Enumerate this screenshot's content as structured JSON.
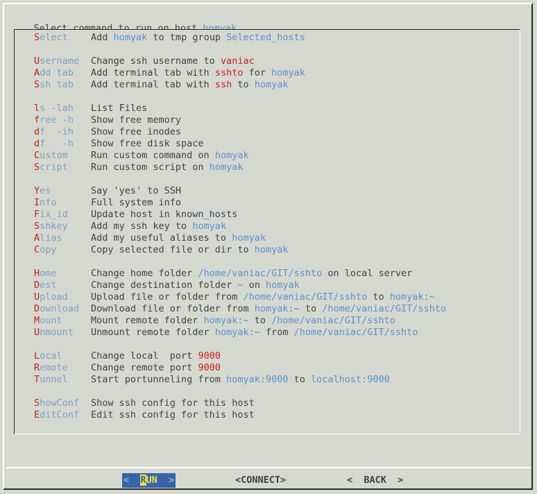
{
  "window": {
    "prompt_prefix": "Select command to run on host ",
    "prompt_host": "homyak",
    "prompt_suffix": "."
  },
  "colors": {
    "background": "#d6d9d0",
    "text": "#3d4144",
    "hotkey_red": "#c32026",
    "keyword_blue": "#7b9fc7",
    "token_blue": "#5a8fd0",
    "token_red": "#c32026",
    "button_highlight_bg": "#3763a8",
    "button_highlight_fg": "#f0e24a",
    "frame_light": "#ffffff",
    "frame_dark": "#23282c"
  },
  "menu": {
    "rows": [
      {
        "blank": false,
        "tag": [
          {
            "t": "S",
            "c": "hk"
          },
          {
            "t": "elect",
            "c": "kw"
          }
        ],
        "desc": [
          {
            "t": "Add ",
            "c": "pl"
          },
          {
            "t": "homyak",
            "c": "bl"
          },
          {
            "t": " to tmp group ",
            "c": "pl"
          },
          {
            "t": "Selected_hosts",
            "c": "bl"
          }
        ]
      },
      {
        "blank": true
      },
      {
        "blank": false,
        "tag": [
          {
            "t": "U",
            "c": "hk"
          },
          {
            "t": "sername",
            "c": "kw"
          }
        ],
        "desc": [
          {
            "t": "Change ssh username to ",
            "c": "pl"
          },
          {
            "t": "vaniac",
            "c": "rd"
          }
        ]
      },
      {
        "blank": false,
        "tag": [
          {
            "t": "A",
            "c": "hk"
          },
          {
            "t": "dd tab",
            "c": "kw"
          }
        ],
        "desc": [
          {
            "t": "Add terminal tab with ",
            "c": "pl"
          },
          {
            "t": "sshto",
            "c": "rd"
          },
          {
            "t": " for ",
            "c": "pl"
          },
          {
            "t": "homyak",
            "c": "bl"
          }
        ]
      },
      {
        "blank": false,
        "tag": [
          {
            "t": "S",
            "c": "hk"
          },
          {
            "t": "sh tab",
            "c": "kw"
          }
        ],
        "desc": [
          {
            "t": "Add terminal tab with ",
            "c": "pl"
          },
          {
            "t": "ssh",
            "c": "rd"
          },
          {
            "t": " to ",
            "c": "pl"
          },
          {
            "t": "homyak",
            "c": "bl"
          }
        ]
      },
      {
        "blank": true
      },
      {
        "blank": false,
        "tag": [
          {
            "t": "l",
            "c": "hk"
          },
          {
            "t": "s -lah",
            "c": "kw"
          }
        ],
        "desc": [
          {
            "t": "List Files",
            "c": "pl"
          }
        ]
      },
      {
        "blank": false,
        "tag": [
          {
            "t": "f",
            "c": "hk"
          },
          {
            "t": "ree -h",
            "c": "kw"
          }
        ],
        "desc": [
          {
            "t": "Show free memory",
            "c": "pl"
          }
        ]
      },
      {
        "blank": false,
        "tag": [
          {
            "t": "d",
            "c": "hk"
          },
          {
            "t": "f  -ih",
            "c": "kw"
          }
        ],
        "desc": [
          {
            "t": "Show free inodes",
            "c": "pl"
          }
        ]
      },
      {
        "blank": false,
        "tag": [
          {
            "t": "d",
            "c": "hk"
          },
          {
            "t": "f   -h",
            "c": "kw"
          }
        ],
        "desc": [
          {
            "t": "Show free disk space",
            "c": "pl"
          }
        ]
      },
      {
        "blank": false,
        "tag": [
          {
            "t": "C",
            "c": "hk"
          },
          {
            "t": "ustom",
            "c": "kw"
          }
        ],
        "desc": [
          {
            "t": "Run custom command on ",
            "c": "pl"
          },
          {
            "t": "homyak",
            "c": "bl"
          }
        ]
      },
      {
        "blank": false,
        "tag": [
          {
            "t": "S",
            "c": "hk"
          },
          {
            "t": "cript",
            "c": "kw"
          }
        ],
        "desc": [
          {
            "t": "Run custom script on ",
            "c": "pl"
          },
          {
            "t": "homyak",
            "c": "bl"
          }
        ]
      },
      {
        "blank": true
      },
      {
        "blank": false,
        "tag": [
          {
            "t": "Y",
            "c": "hk"
          },
          {
            "t": "es",
            "c": "kw"
          }
        ],
        "desc": [
          {
            "t": "Say 'yes' to SSH",
            "c": "pl"
          }
        ]
      },
      {
        "blank": false,
        "tag": [
          {
            "t": "I",
            "c": "hk"
          },
          {
            "t": "nfo",
            "c": "kw"
          }
        ],
        "desc": [
          {
            "t": "Full system info",
            "c": "pl"
          }
        ]
      },
      {
        "blank": false,
        "tag": [
          {
            "t": "F",
            "c": "hk"
          },
          {
            "t": "ix_id",
            "c": "kw"
          }
        ],
        "desc": [
          {
            "t": "Update host in known_hosts",
            "c": "pl"
          }
        ]
      },
      {
        "blank": false,
        "tag": [
          {
            "t": "S",
            "c": "hk"
          },
          {
            "t": "shkey",
            "c": "kw"
          }
        ],
        "desc": [
          {
            "t": "Add my ssh key to ",
            "c": "pl"
          },
          {
            "t": "homyak",
            "c": "bl"
          }
        ]
      },
      {
        "blank": false,
        "tag": [
          {
            "t": "A",
            "c": "hk"
          },
          {
            "t": "lias",
            "c": "kw"
          }
        ],
        "desc": [
          {
            "t": "Add my useful aliases to ",
            "c": "pl"
          },
          {
            "t": "homyak",
            "c": "bl"
          }
        ]
      },
      {
        "blank": false,
        "tag": [
          {
            "t": "C",
            "c": "hk"
          },
          {
            "t": "opy",
            "c": "kw"
          }
        ],
        "desc": [
          {
            "t": "Copy selected file or dir to ",
            "c": "pl"
          },
          {
            "t": "homyak",
            "c": "bl"
          }
        ]
      },
      {
        "blank": true
      },
      {
        "blank": false,
        "tag": [
          {
            "t": "H",
            "c": "hk"
          },
          {
            "t": "ome",
            "c": "kw"
          }
        ],
        "desc": [
          {
            "t": "Change home folder ",
            "c": "pl"
          },
          {
            "t": "/home/vaniac/GIT/sshto",
            "c": "bl"
          },
          {
            "t": " on local server",
            "c": "pl"
          }
        ]
      },
      {
        "blank": false,
        "tag": [
          {
            "t": "D",
            "c": "hk"
          },
          {
            "t": "est",
            "c": "kw"
          }
        ],
        "desc": [
          {
            "t": "Change destination folder ",
            "c": "pl"
          },
          {
            "t": "~",
            "c": "bl"
          },
          {
            "t": " on ",
            "c": "pl"
          },
          {
            "t": "homyak",
            "c": "bl"
          }
        ]
      },
      {
        "blank": false,
        "tag": [
          {
            "t": "U",
            "c": "hk"
          },
          {
            "t": "pload",
            "c": "kw"
          }
        ],
        "desc": [
          {
            "t": "Upload file or folder from ",
            "c": "pl"
          },
          {
            "t": "/home/vaniac/GIT/sshto",
            "c": "bl"
          },
          {
            "t": " to ",
            "c": "pl"
          },
          {
            "t": "homyak:~",
            "c": "bl"
          }
        ]
      },
      {
        "blank": false,
        "tag": [
          {
            "t": "D",
            "c": "hk"
          },
          {
            "t": "ownload",
            "c": "kw"
          }
        ],
        "desc": [
          {
            "t": "Download file or folder from ",
            "c": "pl"
          },
          {
            "t": "homyak:~",
            "c": "bl"
          },
          {
            "t": " to ",
            "c": "pl"
          },
          {
            "t": "/home/vaniac/GIT/sshto",
            "c": "bl"
          }
        ]
      },
      {
        "blank": false,
        "tag": [
          {
            "t": "M",
            "c": "hk"
          },
          {
            "t": "ount",
            "c": "kw"
          }
        ],
        "desc": [
          {
            "t": "Mount remote folder ",
            "c": "pl"
          },
          {
            "t": "homyak:~",
            "c": "bl"
          },
          {
            "t": " to ",
            "c": "pl"
          },
          {
            "t": "/home/vaniac/GIT/sshto",
            "c": "bl"
          }
        ]
      },
      {
        "blank": false,
        "tag": [
          {
            "t": "U",
            "c": "hk"
          },
          {
            "t": "nmount",
            "c": "kw"
          }
        ],
        "desc": [
          {
            "t": "Unmount remote folder ",
            "c": "pl"
          },
          {
            "t": "homyak:~",
            "c": "bl"
          },
          {
            "t": " from ",
            "c": "pl"
          },
          {
            "t": "/home/vaniac/GIT/sshto",
            "c": "bl"
          }
        ]
      },
      {
        "blank": true
      },
      {
        "blank": false,
        "tag": [
          {
            "t": "L",
            "c": "hk"
          },
          {
            "t": "ocal",
            "c": "kw"
          }
        ],
        "desc": [
          {
            "t": "Change local  port ",
            "c": "pl"
          },
          {
            "t": "9000",
            "c": "rd"
          }
        ]
      },
      {
        "blank": false,
        "tag": [
          {
            "t": "R",
            "c": "hk"
          },
          {
            "t": "emote",
            "c": "kw"
          }
        ],
        "desc": [
          {
            "t": "Change remote port ",
            "c": "pl"
          },
          {
            "t": "9000",
            "c": "rd"
          }
        ]
      },
      {
        "blank": false,
        "tag": [
          {
            "t": "T",
            "c": "hk"
          },
          {
            "t": "unnel",
            "c": "kw"
          }
        ],
        "desc": [
          {
            "t": "Start portunneling from ",
            "c": "pl"
          },
          {
            "t": "homyak:9000",
            "c": "bl"
          },
          {
            "t": " to ",
            "c": "pl"
          },
          {
            "t": "localhost:9000",
            "c": "bl"
          }
        ]
      },
      {
        "blank": true
      },
      {
        "blank": false,
        "tag": [
          {
            "t": "S",
            "c": "hk"
          },
          {
            "t": "howConf",
            "c": "kw"
          }
        ],
        "desc": [
          {
            "t": "Show ssh config for this host",
            "c": "pl"
          }
        ]
      },
      {
        "blank": false,
        "tag": [
          {
            "t": "E",
            "c": "hk"
          },
          {
            "t": "ditConf",
            "c": "kw"
          }
        ],
        "desc": [
          {
            "t": "Edit ssh config for this host",
            "c": "pl"
          }
        ]
      }
    ]
  },
  "buttons": {
    "run": {
      "left_arrow": "<",
      "pad_l": "  ",
      "cursor_letter": "R",
      "rest": "UN",
      "pad_r": "  ",
      "right_arrow": ">"
    },
    "connect": {
      "label": "<CONNECT>"
    },
    "back": {
      "label": "<  BACK  >"
    }
  }
}
